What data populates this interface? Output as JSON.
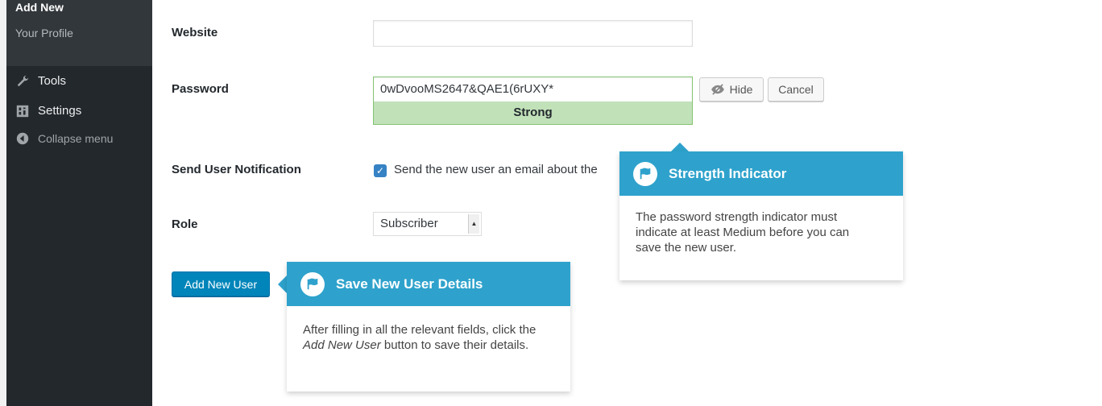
{
  "sidebar": {
    "submenu": {
      "current": "Add New",
      "profile": "Your Profile"
    },
    "items": [
      {
        "label": "Tools",
        "icon": "wrench-icon"
      },
      {
        "label": "Settings",
        "icon": "settings-icon"
      },
      {
        "label": "Collapse menu",
        "icon": "collapse-arrow-icon"
      }
    ]
  },
  "form": {
    "website_label": "Website",
    "website_value": "",
    "password_label": "Password",
    "password_value": "0wDvooMS2647&QAE1(6rUXY*",
    "strength": "Strong",
    "hide_label": "Hide",
    "cancel_label": "Cancel",
    "notification_label": "Send User Notification",
    "notification_text": "Send the new user an email about the",
    "notification_checked": true,
    "role_label": "Role",
    "role_value": "Subscriber",
    "submit_label": "Add New User"
  },
  "pointers": {
    "strength": {
      "title": "Strength Indicator",
      "body": "The password strength indicator must indicate at least Medium before you can save the new user."
    },
    "save": {
      "title": "Save New User Details",
      "body_before": "After filling in all the relevant fields, click the ",
      "body_em": "Add New User",
      "body_after": " button to save their details."
    }
  },
  "colors": {
    "sidebar": "#23282d",
    "submenu": "#32373c",
    "primary": "#0085ba",
    "pointer_header": "#2ea2cc",
    "strength_bg": "#c1e1b9",
    "checkbox": "#3582c4"
  }
}
